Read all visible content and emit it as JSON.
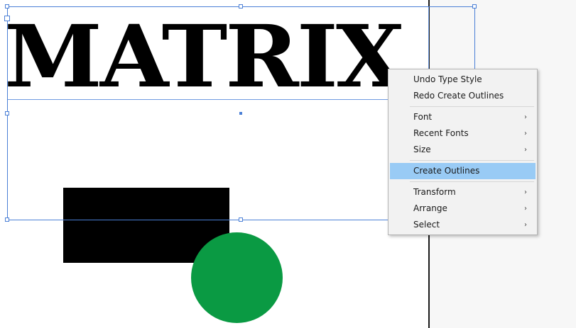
{
  "artwork": {
    "title_text": "MATRIX",
    "colors": {
      "text": "#000000",
      "rectangle": "#000000",
      "circle": "#0a9a43",
      "selection": "#4a7fd6",
      "menu_highlight": "#99cbf5"
    }
  },
  "context_menu": {
    "items": [
      {
        "label": "Undo Type Style",
        "submenu": false,
        "highlighted": false
      },
      {
        "label": "Redo Create Outlines",
        "submenu": false,
        "highlighted": false
      },
      {
        "label": "Font",
        "submenu": true,
        "highlighted": false
      },
      {
        "label": "Recent Fonts",
        "submenu": true,
        "highlighted": false
      },
      {
        "label": "Size",
        "submenu": true,
        "highlighted": false
      },
      {
        "label": "Create Outlines",
        "submenu": false,
        "highlighted": true
      },
      {
        "label": "Transform",
        "submenu": true,
        "highlighted": false
      },
      {
        "label": "Arrange",
        "submenu": true,
        "highlighted": false
      },
      {
        "label": "Select",
        "submenu": true,
        "highlighted": false
      }
    ],
    "submenu_arrow": "chevron-right-icon"
  }
}
